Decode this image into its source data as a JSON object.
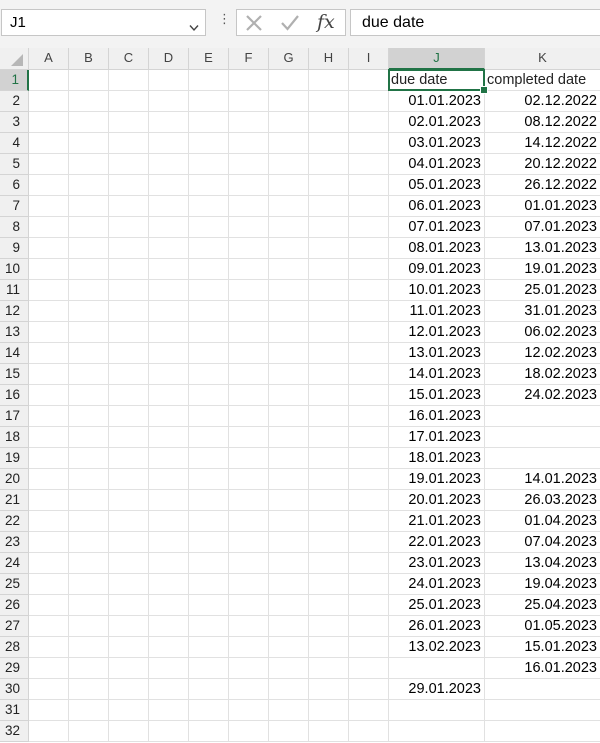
{
  "name_box": {
    "value": "J1"
  },
  "formula_bar": {
    "value": "due date"
  },
  "columns": [
    "A",
    "B",
    "C",
    "D",
    "E",
    "F",
    "G",
    "H",
    "I",
    "J",
    "K"
  ],
  "rows": [
    "1",
    "2",
    "3",
    "4",
    "5",
    "6",
    "7",
    "8",
    "9",
    "10",
    "11",
    "12",
    "13",
    "14",
    "15",
    "16",
    "17",
    "18",
    "19",
    "20",
    "21",
    "22",
    "23",
    "24",
    "25",
    "26",
    "27",
    "28",
    "29",
    "30",
    "31",
    "32"
  ],
  "selected_cell": "J1",
  "accent_color": "#217346",
  "icons": [
    "chevron-down-icon",
    "more-dots-icon",
    "cancel-icon",
    "enter-icon",
    "fx-icon"
  ],
  "cells": {
    "J": [
      "due date",
      "01.01.2023",
      "02.01.2023",
      "03.01.2023",
      "04.01.2023",
      "05.01.2023",
      "06.01.2023",
      "07.01.2023",
      "08.01.2023",
      "09.01.2023",
      "10.01.2023",
      "11.01.2023",
      "12.01.2023",
      "13.01.2023",
      "14.01.2023",
      "15.01.2023",
      "16.01.2023",
      "17.01.2023",
      "18.01.2023",
      "19.01.2023",
      "20.01.2023",
      "21.01.2023",
      "22.01.2023",
      "23.01.2023",
      "24.01.2023",
      "25.01.2023",
      "26.01.2023",
      "13.02.2023",
      "",
      "29.01.2023",
      "",
      ""
    ],
    "K": [
      "completed date",
      "02.12.2022",
      "08.12.2022",
      "14.12.2022",
      "20.12.2022",
      "26.12.2022",
      "01.01.2023",
      "07.01.2023",
      "13.01.2023",
      "19.01.2023",
      "25.01.2023",
      "31.01.2023",
      "06.02.2023",
      "12.02.2023",
      "18.02.2023",
      "24.02.2023",
      "",
      "",
      "",
      "14.01.2023",
      "26.03.2023",
      "01.04.2023",
      "07.04.2023",
      "13.04.2023",
      "19.04.2023",
      "25.04.2023",
      "01.05.2023",
      "15.01.2023",
      "16.01.2023",
      "",
      "",
      ""
    ]
  }
}
